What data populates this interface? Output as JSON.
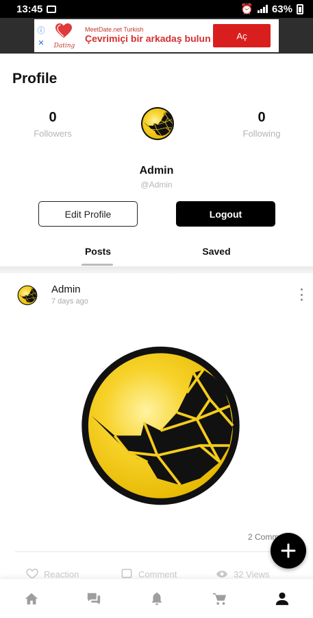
{
  "status_bar": {
    "time": "13:45",
    "battery": "63%"
  },
  "ad": {
    "source": "MeetDate.net Turkish",
    "title": "Çevrimiçi bir arkadaş bulun",
    "logo_text": "Dating",
    "cta": "Aç"
  },
  "header": {
    "title": "Profile"
  },
  "stats": {
    "followers": {
      "count": "0",
      "label": "Followers"
    },
    "following": {
      "count": "0",
      "label": "Following"
    }
  },
  "user": {
    "name": "Admin",
    "handle": "@Admin"
  },
  "buttons": {
    "edit_profile": "Edit Profile",
    "logout": "Logout"
  },
  "tabs": [
    {
      "label": "Posts",
      "active": true
    },
    {
      "label": "Saved",
      "active": false
    }
  ],
  "post": {
    "author": "Admin",
    "time": "7 days ago",
    "comments_label": "2 Comm",
    "actions": {
      "reaction": "Reaction",
      "comment": "Comment",
      "views": "32 Views"
    }
  },
  "bottom_nav": [
    {
      "icon": "home-icon"
    },
    {
      "icon": "chat-icon"
    },
    {
      "icon": "bell-icon"
    },
    {
      "icon": "cart-icon"
    },
    {
      "icon": "user-icon",
      "active": true
    }
  ],
  "colors": {
    "accent": "#000000",
    "brand_yellow": "#f5cc1b",
    "ad_button": "#d91e1e"
  }
}
